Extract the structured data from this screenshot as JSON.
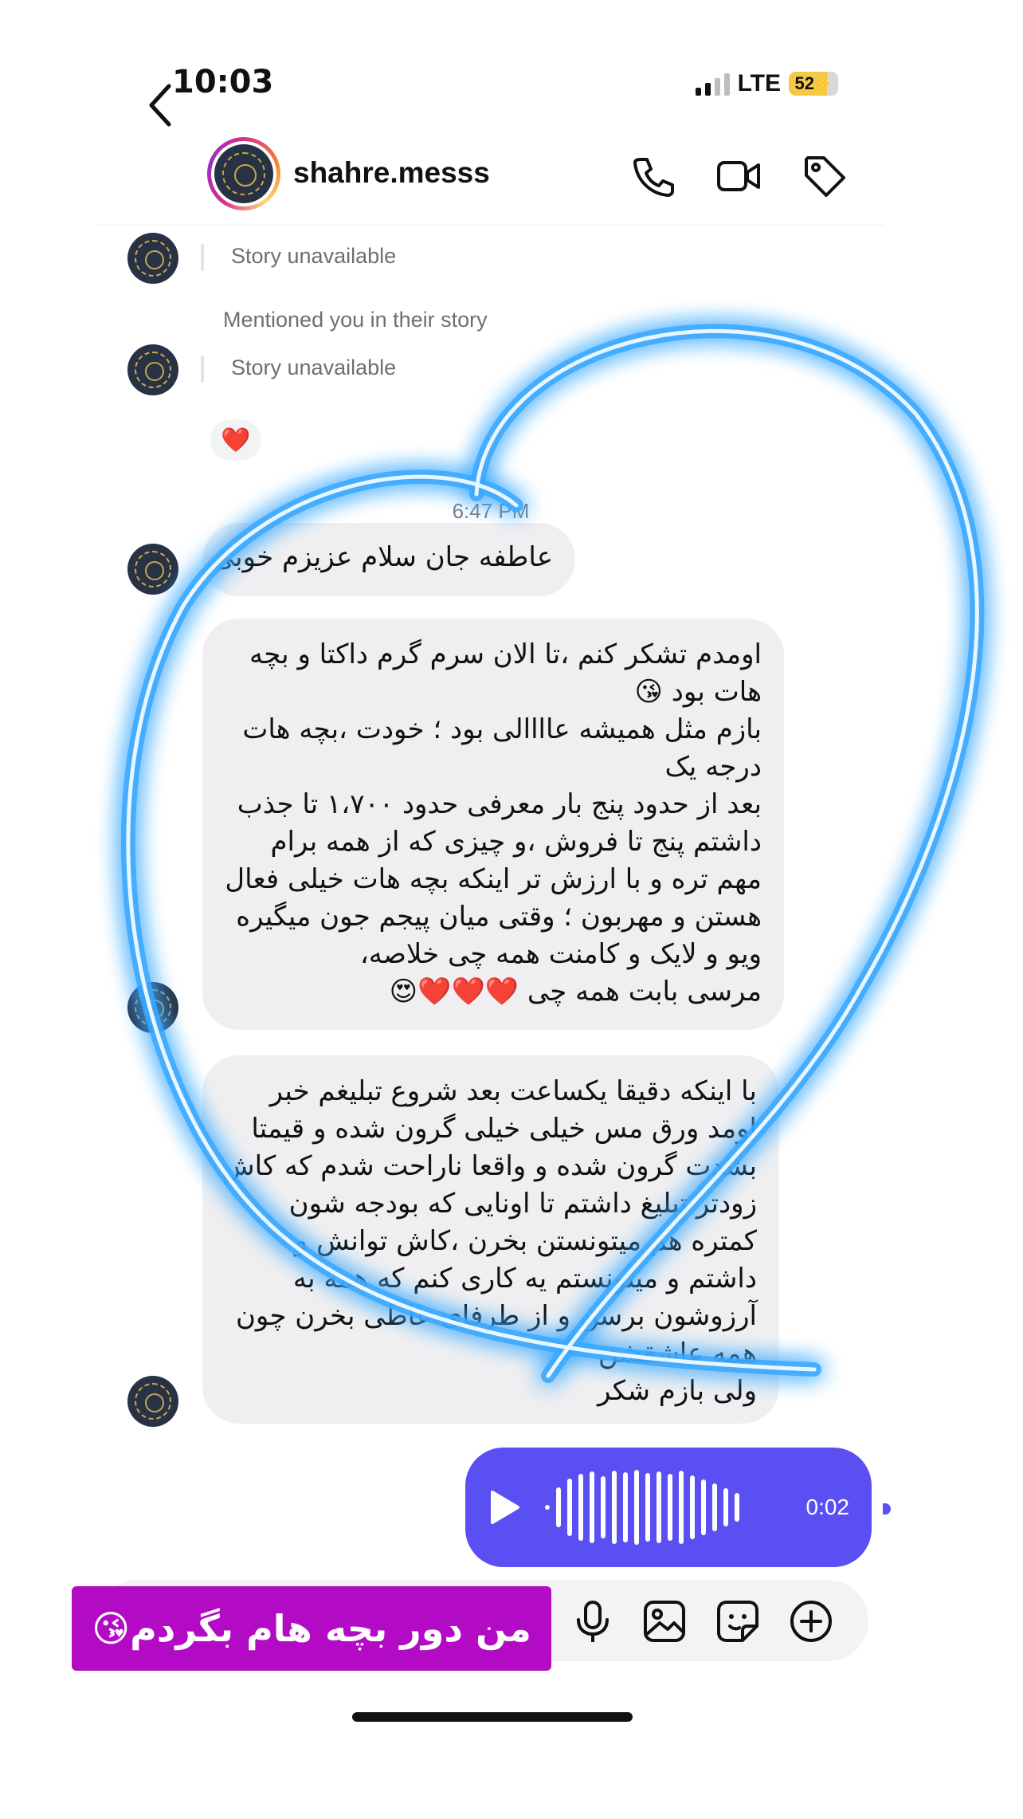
{
  "status_bar": {
    "time": "10:03",
    "network": "LTE",
    "battery": "52"
  },
  "header": {
    "username": "shahre.messs",
    "icons": [
      "back-chevron-icon",
      "phone-icon",
      "video-icon",
      "tag-icon"
    ]
  },
  "chat": {
    "story1": "Story unavailable",
    "mention": "Mentioned you in their story",
    "story2": "Story unavailable",
    "reaction": "❤️",
    "timestamp": "6:47 PM",
    "msg1": "عاطفه جان سلام عزیزم خوبی",
    "msg2_lines": [
      "اومدم تشکر کنم ،تا الان سرم گرم داکتا و بچه",
      "هات بود 😘",
      "بازم مثل همیشه عاااالی بود ؛ خودت ،بچه هات",
      "درجه یک",
      "بعد از حدود پنج بار معرفی حدود ۱،۷۰۰ تا جذب",
      "داشتم پنج تا فروش ،و چیزی که از همه برام",
      "مهم تره و با ارزش تر اینکه بچه هات خیلی فعال",
      "هستن و مهربون ؛ وقتی میان پیجم جون میگیره",
      "ویو و لایک و کامنت همه چی خلاصه،",
      "مرسی بابت همه چی ❤️❤️❤️😍"
    ],
    "msg3_lines": [
      "با اینکه دقیقا یکساعت بعد شروع تبلیغم خبر",
      "اومد ورق مس خیلی خیلی گرون شده و قیمتا",
      "بشدت گرون شده و واقعا ناراحت شدم که کاش",
      "زودتر تبلیغ داشتم تا اونایی که بودجه شون",
      "کمتره هم میتونستن بخرن ،کاش توانش و",
      "داشتم و میتونستم یه کاری کنم که همه به",
      "آرزوشون برسن و از طرفای عاطی بخرن چون",
      "همه عاشقشن",
      "ولی بازم شکر"
    ],
    "voice": {
      "duration": "0:02"
    }
  },
  "composer": {
    "icons": [
      "mic-icon",
      "gallery-icon",
      "sticker-icon",
      "add-icon"
    ]
  },
  "caption": {
    "text": "من دور بچه هام بگردم😘"
  },
  "colors": {
    "voice_bubble": "#5a4ff3",
    "caption_bg": "#b30ac5",
    "neon": "#39a8ff"
  }
}
